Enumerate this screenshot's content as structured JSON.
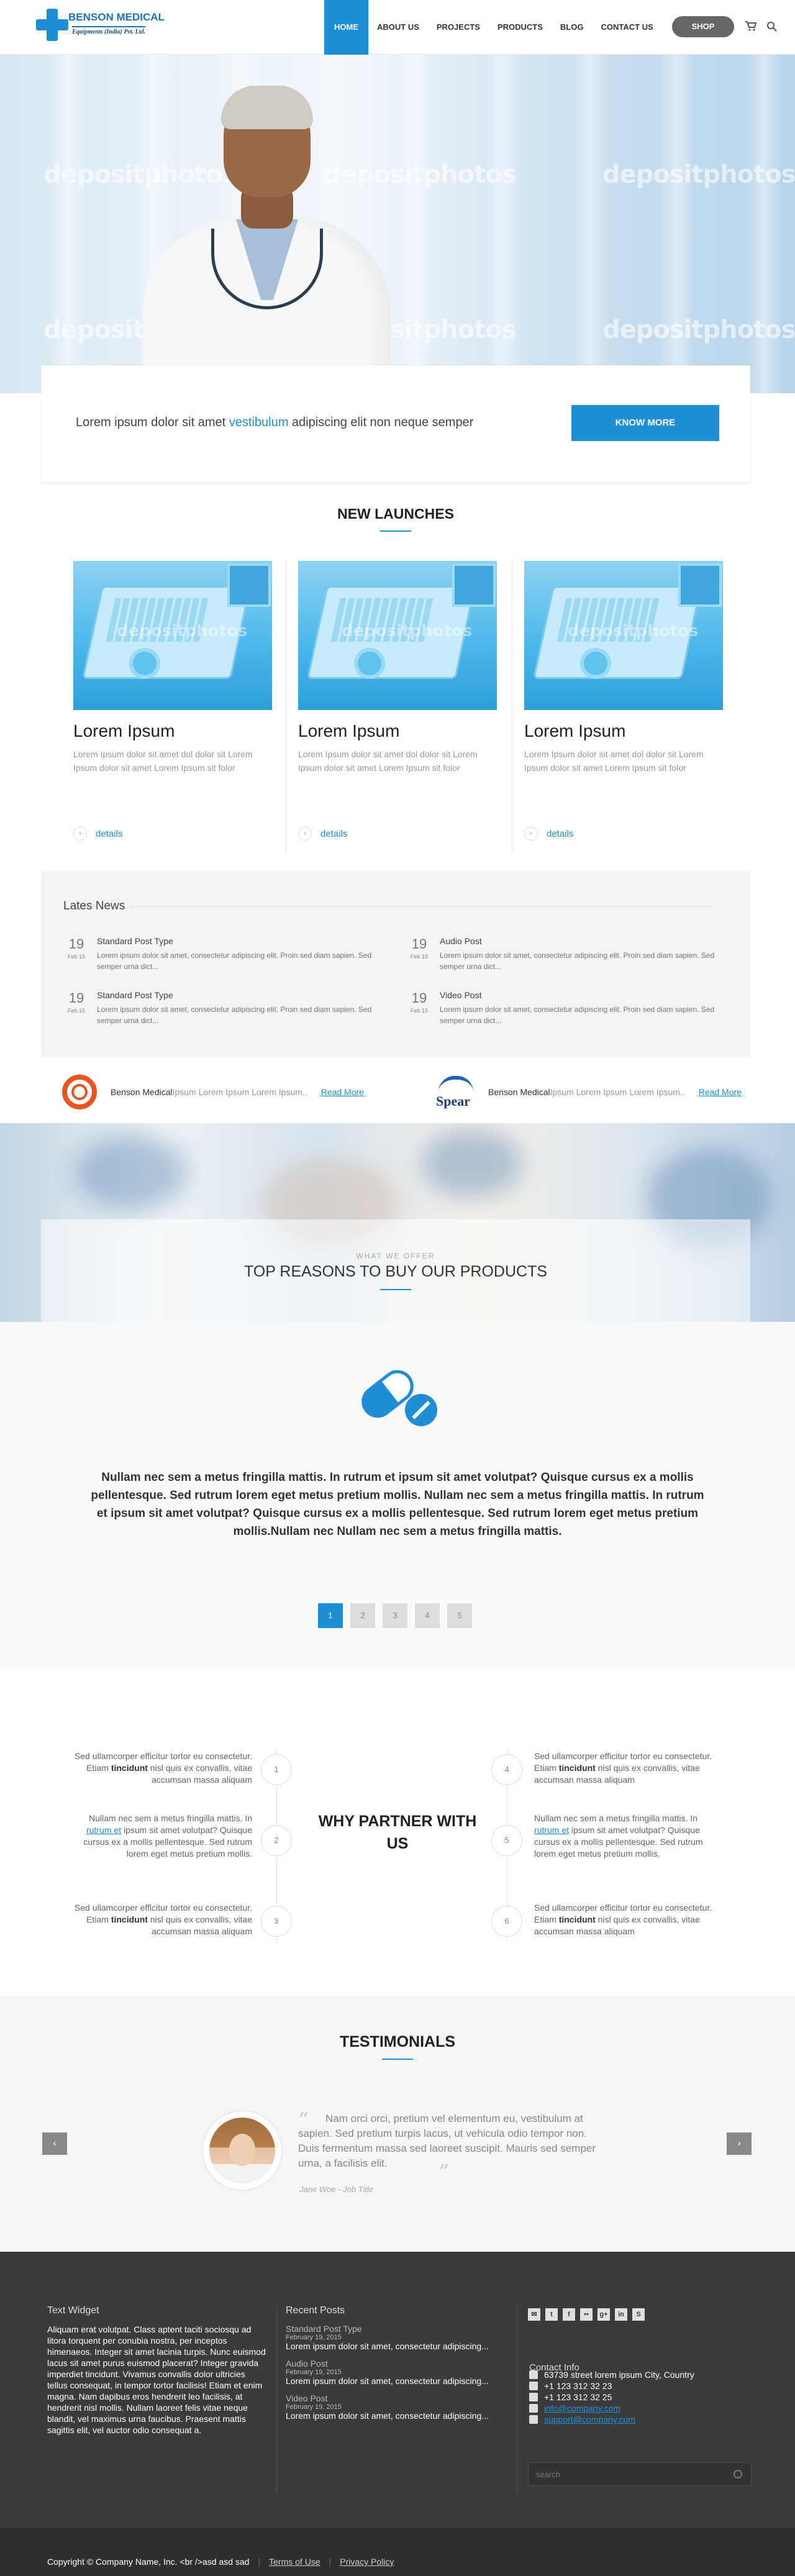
{
  "header": {
    "logo_name": "BENSON MEDICAL",
    "logo_tagline": "Equipments (India) Pvt. Ltd.",
    "nav": [
      "HOME",
      "ABOUT US",
      "PROJECTS",
      "PRODUCTS",
      "BLOG",
      "CONTACT US"
    ],
    "active_nav": "HOME",
    "shop_label": "SHOP",
    "accent": "#1e8fd6"
  },
  "hero": {
    "watermark": "depositphotos"
  },
  "cta": {
    "text_before": "Lorem ipsum dolor sit amet ",
    "text_link": "vestibulum",
    "text_after": " adipiscing elit non neque semper",
    "button": "KNOW MORE"
  },
  "launches": {
    "title": "NEW LAUNCHES",
    "cards": [
      {
        "title": "Lorem Ipsum",
        "desc": "Lorem Ipsum dolor sit amet dol dolor sit Lorem Ipsum dolor sit amet Lorem Ipsum sit folor",
        "link": "details"
      },
      {
        "title": "Lorem Ipsum",
        "desc": "Lorem Ipsum dolor sit amet dol dolor sit Lorem Ipsum dolor sit amet Lorem Ipsum sit folor",
        "link": "details"
      },
      {
        "title": "Lorem Ipsum",
        "desc": "Lorem Ipsum dolor sit amet dol dolor sit Lorem Ipsum dolor sit amet Lorem Ipsum sit folor",
        "link": "details"
      }
    ]
  },
  "news": {
    "title": "Lates News",
    "items": [
      {
        "day": "19",
        "month": "Feb 15",
        "title": "Standard Post Type",
        "text": "Lorem ipsum dolor sit amet, consectetur adipiscing elit. Proin sed diam sapien. Sed semper urna dict..."
      },
      {
        "day": "19",
        "month": "Feb 15",
        "title": "Audio Post",
        "text": "Lorem ipsum dolor sit amet, consectetur adipiscing elit. Proin sed diam sapien. Sed semper urna dict..."
      },
      {
        "day": "19",
        "month": "Feb 15",
        "title": "Standard Post Type",
        "text": "Lorem ipsum dolor sit amet, consectetur adipiscing elit. Proin sed diam sapien. Sed semper urna dict..."
      },
      {
        "day": "19",
        "month": "Feb 15",
        "title": "Video Post",
        "text": "Lorem ipsum dolor sit amet, consectetur adipiscing elit. Proin sed diam sapien. Sed semper urna dict..."
      }
    ]
  },
  "partners": [
    {
      "name": "Benson Medical",
      "text": " Ipsum Lorem Ipsum Lorem Ipsum..",
      "link": "Read More"
    },
    {
      "name": "Benson Medical",
      "text": " Ipsum Lorem Ipsum Lorem Ipsum..",
      "link": "Read More",
      "logo_text": "Spear"
    }
  ],
  "reasons": {
    "kicker": "WHAT WE OFFER",
    "title": "TOP REASONS TO BUY OUR PRODUCTS"
  },
  "pills": {
    "text": "Nullam nec sem a metus fringilla mattis. In rutrum et ipsum sit amet volutpat? Quisque cursus ex a mollis pellentesque. Sed rutrum lorem eget metus pretium mollis. Nullam nec sem a metus fringilla mattis. In rutrum et ipsum sit amet volutpat? Quisque cursus ex a mollis pellentesque. Sed rutrum lorem eget metus pretium mollis.Nullam nec Nullam nec sem a metus fringilla mattis.",
    "pages": [
      "1",
      "2",
      "3",
      "4",
      "5"
    ],
    "current_page": "1"
  },
  "why": {
    "title": "WHY PARTNER WITH US",
    "items": [
      {
        "num": "1",
        "pre": "Sed ullamcorper efficitur tortor eu consectetur. Etiam ",
        "bold": "tincidunt",
        "post": " nisl quis ex convallis, vitae accumsan massa aliquam"
      },
      {
        "num": "2",
        "pre": "Nullam nec sem a metus fringilla mattis. In ",
        "link": "rutrum et",
        "post": " ipsum sit amet volutpat? Quisque cursus ex a mollis pellentesque. Sed rutrum lorem eget metus pretium mollis."
      },
      {
        "num": "3",
        "pre": "Sed ullamcorper efficitur tortor eu consectetur. Etiam ",
        "bold": "tincidunt",
        "post": " nisl quis ex convallis, vitae accumsan massa aliquam"
      },
      {
        "num": "4",
        "pre": "Sed ullamcorper efficitur tortor eu consectetur. Etiam ",
        "bold": "tincidunt",
        "post": " nisl quis ex convallis, vitae accumsan massa aliquam"
      },
      {
        "num": "5",
        "pre": "Nullam nec sem a metus fringilla mattis. In ",
        "link": "rutrum et",
        "post": " ipsum sit amet volutpat? Quisque cursus ex a mollis pellentesque. Sed rutrum lorem eget metus pretium mollis."
      },
      {
        "num": "6",
        "pre": "Sed ullamcorper efficitur tortor eu consectetur. Etiam ",
        "bold": "tincidunt",
        "post": " nisl quis ex convallis, vitae accumsan massa aliquam"
      }
    ]
  },
  "testimonials": {
    "title": "TESTIMONIALS",
    "quote": "Nam orci orci, pretium vel elementum eu, vestibulum at sapien. Sed pretium turpis lacus, ut vehicula odio tempor non. Duis fermentum massa sed laoreet suscipit. Mauris sed semper urna, a facilisis elit.",
    "author": "Jane Woe - Job Title",
    "prev": "‹",
    "next": "›"
  },
  "footer": {
    "text_widget_title": "Text Widget",
    "text_widget": "Aliquam erat volutpat. Class aptent taciti sociosqu ad litora torquent per conubia nostra, per inceptos himenaeos. Integer sit amet lacinia turpis. Nunc euismod lacus sit amet purus euismod placerat? Integer gravida imperdiet tincidunt. Vivamus convallis dolor ultricies tellus consequat, in tempor tortor facilisis! Etiam et enim magna. Nam dapibus eros hendrerit leo facilisis, at hendrerit nisl mollis. Nullam laoreet felis vitae neque blandit, vel maximus urna faucibus. Praesent mattis sagittis elit, vel auctor odio consequat a.",
    "recent_title": "Recent Posts",
    "recent": [
      {
        "title": "Standard Post Type",
        "date": "February 19, 2015",
        "text": "Lorem ipsum dolor sit amet, consectetur adipiscing..."
      },
      {
        "title": "Audio Post",
        "date": "February 19, 2015",
        "text": "Lorem ipsum dolor sit amet, consectetur adipiscing..."
      },
      {
        "title": "Video Post",
        "date": "February 19, 2015",
        "text": "Lorem ipsum dolor sit amet, consectetur adipiscing..."
      }
    ],
    "social": [
      "mail-icon",
      "twitter-icon",
      "facebook-icon",
      "flickr-icon",
      "google-plus-icon",
      "linkedin-icon",
      "skype-icon"
    ],
    "contact_title": "Contact Info",
    "address": "63739 street lorem ipsum City, Country",
    "phone": "+1 123 312 32 23",
    "mobile": "+1 123 312 32 25",
    "email1": "info@company.com",
    "email2": "support@company.com",
    "search_placeholder": "search"
  },
  "copyright": {
    "text": "Copyright © Company Name, Inc. <br />asd asd sad",
    "terms": "Terms of Use",
    "privacy": "Privacy Policy"
  }
}
